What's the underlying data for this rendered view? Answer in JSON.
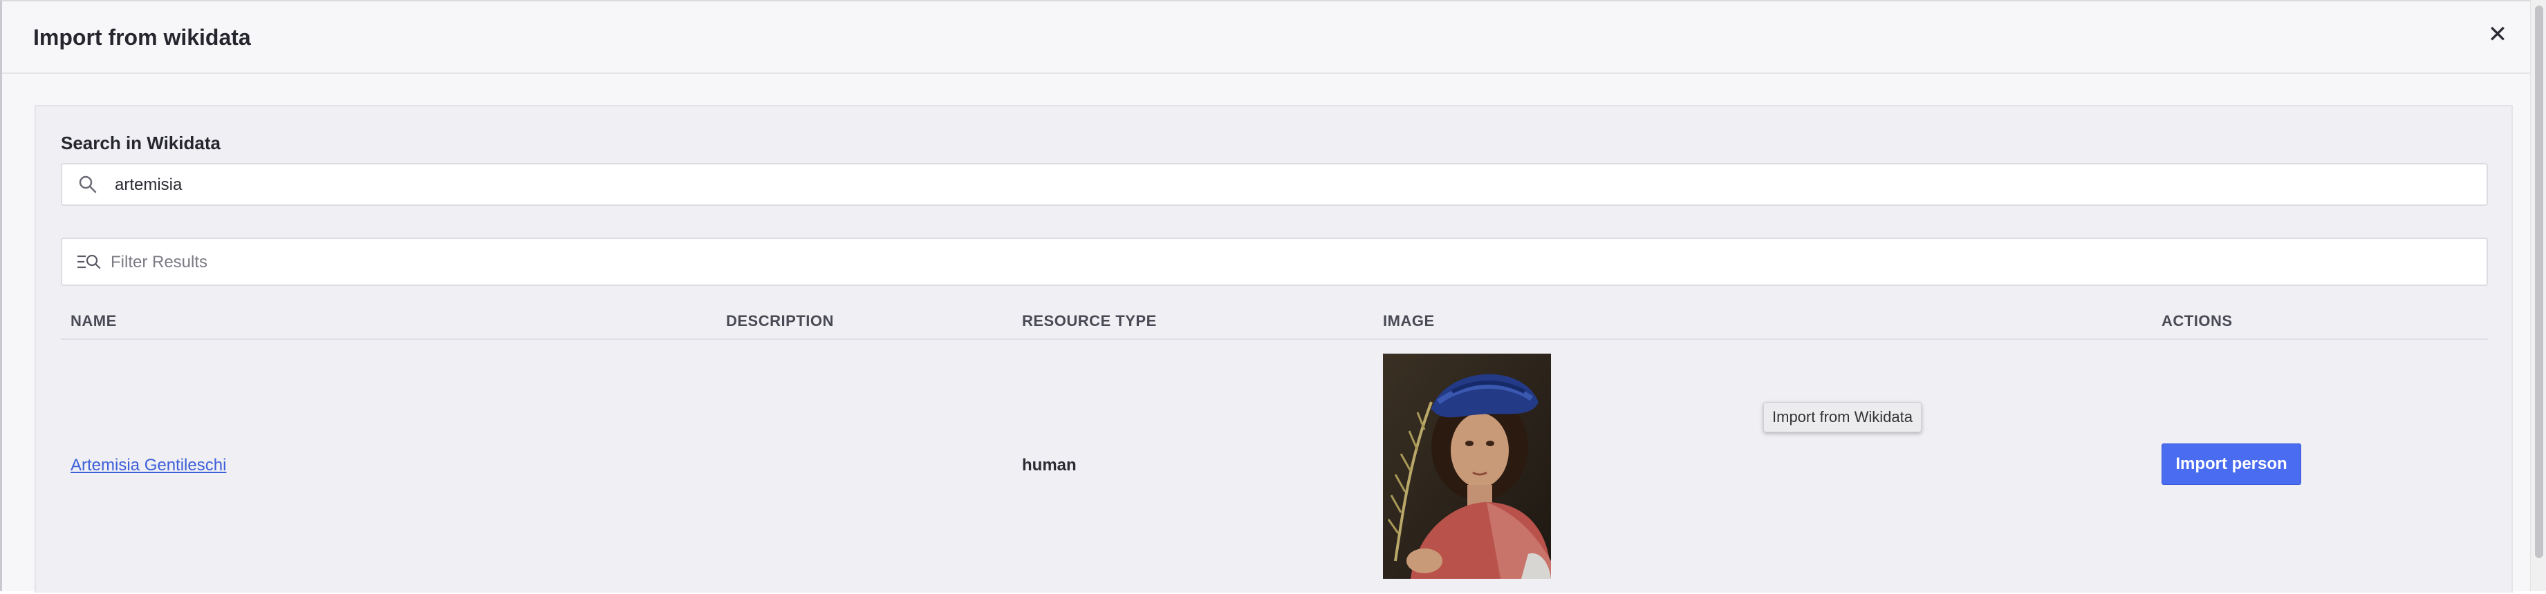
{
  "modal": {
    "title": "Import from wikidata",
    "close_icon": "close-icon"
  },
  "search": {
    "label": "Search in Wikidata",
    "value": "artemisia",
    "icon": "search-icon"
  },
  "filter": {
    "placeholder": "Filter Results",
    "icon": "filter-list-search-icon"
  },
  "table": {
    "columns": [
      "NAME",
      "DESCRIPTION",
      "RESOURCE TYPE",
      "IMAGE",
      "ACTIONS"
    ],
    "rows": [
      {
        "name": "Artemisia Gentileschi",
        "description": "",
        "resource_type": "human",
        "image_alt": "portrait-image",
        "tooltip": "Import from Wikidata",
        "action_label": "Import person"
      }
    ]
  },
  "colors": {
    "accent": "#4a6cf0",
    "link": "#3d5fd9"
  }
}
